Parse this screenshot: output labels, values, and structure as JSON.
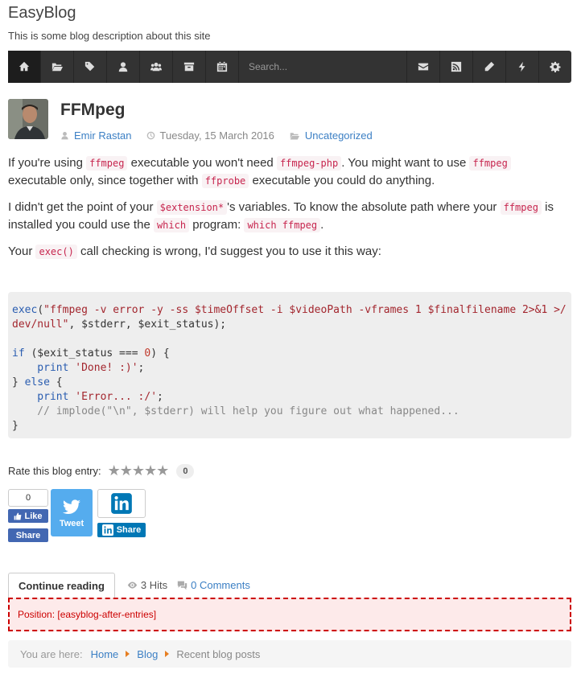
{
  "site": {
    "title": "EasyBlog",
    "description": "This is some blog description about this site"
  },
  "toolbar": {
    "search_placeholder": "Search...",
    "left_icons": [
      "home-icon",
      "folder-open-icon",
      "tags-icon",
      "user-icon",
      "users-icon",
      "archive-icon",
      "calendar-icon"
    ],
    "right_icons": [
      "envelope-icon",
      "rss-icon",
      "pencil-icon",
      "bolt-icon",
      "gear-icon"
    ]
  },
  "post": {
    "title": "FFMpeg",
    "author": "Emir Rastan",
    "date": "Tuesday, 15 March 2016",
    "category": "Uncategorized",
    "p1": {
      "t1": "If you're using ",
      "c1": "ffmpeg",
      "t2": " executable you won't need ",
      "c2": "ffmpeg-php",
      "t3": ". You might want to use ",
      "c3": "ffmpeg",
      "t4": " executable only, since together with ",
      "c4": "ffprobe",
      "t5": " executable you could do anything."
    },
    "p2": {
      "t1": "I didn't get the point of your ",
      "c1": "$extension*",
      "t2": "'s variables. To know the absolute path where your ",
      "c2": "ffmpeg",
      "t3": " is installed you could use the ",
      "c3": "which",
      "t4": " program: ",
      "c4": "which ffmpeg",
      "t5": "."
    },
    "p3": {
      "t1": "Your ",
      "c1": "exec()",
      "t2": " call checking is wrong, I'd suggest you to use it this way:"
    },
    "code": {
      "l1a": "exec",
      "l1b": "(",
      "l1c": "\"ffmpeg -v error -y -ss $timeOffset -i $videoPath -vframes 1 $finalfilename 2>&1 >/",
      "l2a": "dev/null\"",
      "l2b": ", $stderr, $exit_status);",
      "l4a": "if",
      "l4b": " ($exit_status === ",
      "l4c": "0",
      "l4d": ") {",
      "l5a": "    print",
      "l5b": " 'Done! :)'",
      "l5c": ";",
      "l6a": "} ",
      "l6b": "else",
      "l6c": " {",
      "l7a": "    print",
      "l7b": " 'Error... :/'",
      "l7c": ";",
      "l8": "    // implode(\"\\n\", $stderr) will help you figure out what happened...",
      "l9": "}"
    }
  },
  "rating": {
    "label": "Rate this blog entry:",
    "stars": "★★★★★",
    "count": "0"
  },
  "social": {
    "fb_count": "0",
    "fb_like": "Like",
    "fb_share": "Share",
    "tweet": "Tweet",
    "li_share": "Share"
  },
  "footer": {
    "continue_label": "Continue reading",
    "hits": "3 Hits",
    "comments": "0 Comments",
    "position": "Position: [easyblog-after-entries]"
  },
  "breadcrumb": {
    "prefix": "You are here:",
    "home": "Home",
    "blog": "Blog",
    "current": "Recent blog posts"
  },
  "colors": {
    "toolbar_bg": "#333333",
    "link": "#3b7fc4",
    "inline_code": "#c7254e",
    "facebook": "#4267b2",
    "twitter": "#55acee",
    "linkedin": "#0077b5",
    "position_border": "#cc0000"
  }
}
